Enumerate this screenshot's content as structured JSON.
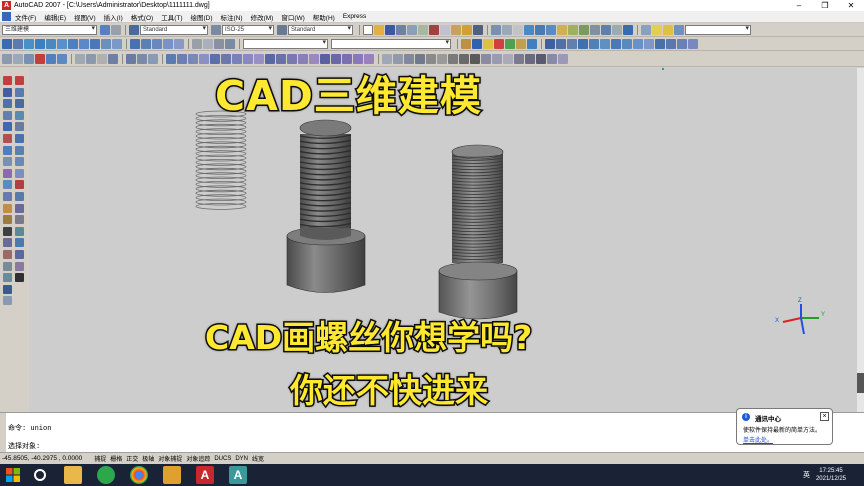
{
  "window": {
    "title": "AutoCAD 2007 - [C:\\Users\\Administrator\\Desktop\\1111111.dwg]",
    "controls": [
      "–",
      "❐",
      "✕"
    ]
  },
  "menu": [
    "文件(F)",
    "编辑(E)",
    "视图(V)",
    "插入(I)",
    "格式(O)",
    "工具(T)",
    "绘图(D)",
    "标注(N)",
    "修改(M)",
    "窗口(W)",
    "帮助(H)",
    "Express"
  ],
  "toolbar": {
    "workspace": "三维建模",
    "text_style": "Standard",
    "dim_style": "ISO-25",
    "table_style": "Standard"
  },
  "captions": {
    "top": "CAD三维建模",
    "middle": "CAD画螺丝你想学吗?",
    "bottom": "你还不快进来"
  },
  "command": {
    "line1": "命令: union",
    "line2": "选择对象:"
  },
  "status": {
    "coords": "-45.8505, -40.2975 , 0.0000",
    "buttons": [
      "捕捉",
      "栅格",
      "正交",
      "极轴",
      "对象捕捉",
      "对象追踪",
      "DUCS",
      "DYN",
      "线宽"
    ]
  },
  "notification": {
    "title": "通讯中心",
    "text": "使软件保持最新的简单方法。",
    "link": "单击此处。"
  },
  "tray": {
    "lang": "英",
    "time": "17:25:45",
    "date": "2021/12/25"
  },
  "colors": {
    "viewport_bg": "#cdcdcd",
    "caption_fill": "#ffe930",
    "caption_stroke": "#111111",
    "bolt_body": "#6e6e6e",
    "axis_x": "#e02020",
    "axis_y": "#20a020",
    "axis_z": "#2050e0"
  }
}
